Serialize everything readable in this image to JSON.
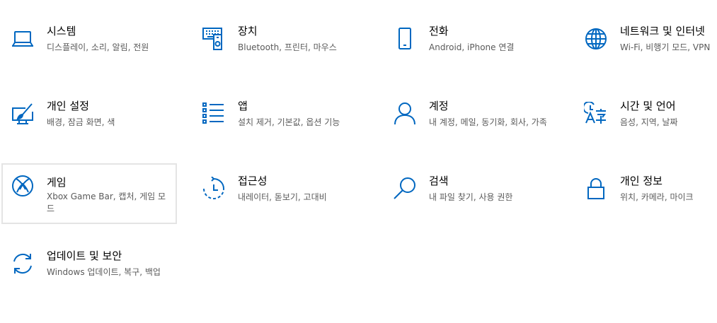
{
  "accent_color": "#0067c0",
  "tiles": [
    {
      "title": "시스템",
      "desc": "디스플레이, 소리, 알림, 전원",
      "icon": "laptop-icon"
    },
    {
      "title": "장치",
      "desc": "Bluetooth, 프린터, 마우스",
      "icon": "devices-icon"
    },
    {
      "title": "전화",
      "desc": "Android, iPhone 연결",
      "icon": "phone-icon"
    },
    {
      "title": "네트워크 및 인터넷",
      "desc": "Wi-Fi, 비행기 모드, VPN",
      "icon": "globe-icon"
    },
    {
      "title": "개인 설정",
      "desc": "배경, 잠금 화면, 색",
      "icon": "personalization-icon"
    },
    {
      "title": "앱",
      "desc": "설치 제거, 기본값, 옵션 기능",
      "icon": "apps-list-icon"
    },
    {
      "title": "계정",
      "desc": "내 계정, 메일, 동기화, 회사, 가족",
      "icon": "person-icon"
    },
    {
      "title": "시간 및 언어",
      "desc": "음성, 지역, 날짜",
      "icon": "time-language-icon"
    },
    {
      "title": "게임",
      "desc": "Xbox Game Bar, 캡처, 게임 모드",
      "icon": "xbox-icon"
    },
    {
      "title": "접근성",
      "desc": "내레이터, 돋보기, 고대비",
      "icon": "accessibility-icon"
    },
    {
      "title": "검색",
      "desc": "내 파일 찾기, 사용 권한",
      "icon": "search-icon"
    },
    {
      "title": "개인 정보",
      "desc": "위치, 카메라, 마이크",
      "icon": "lock-icon"
    },
    {
      "title": "업데이트 및 보안",
      "desc": "Windows 업데이트, 복구, 백업",
      "icon": "sync-icon"
    }
  ]
}
